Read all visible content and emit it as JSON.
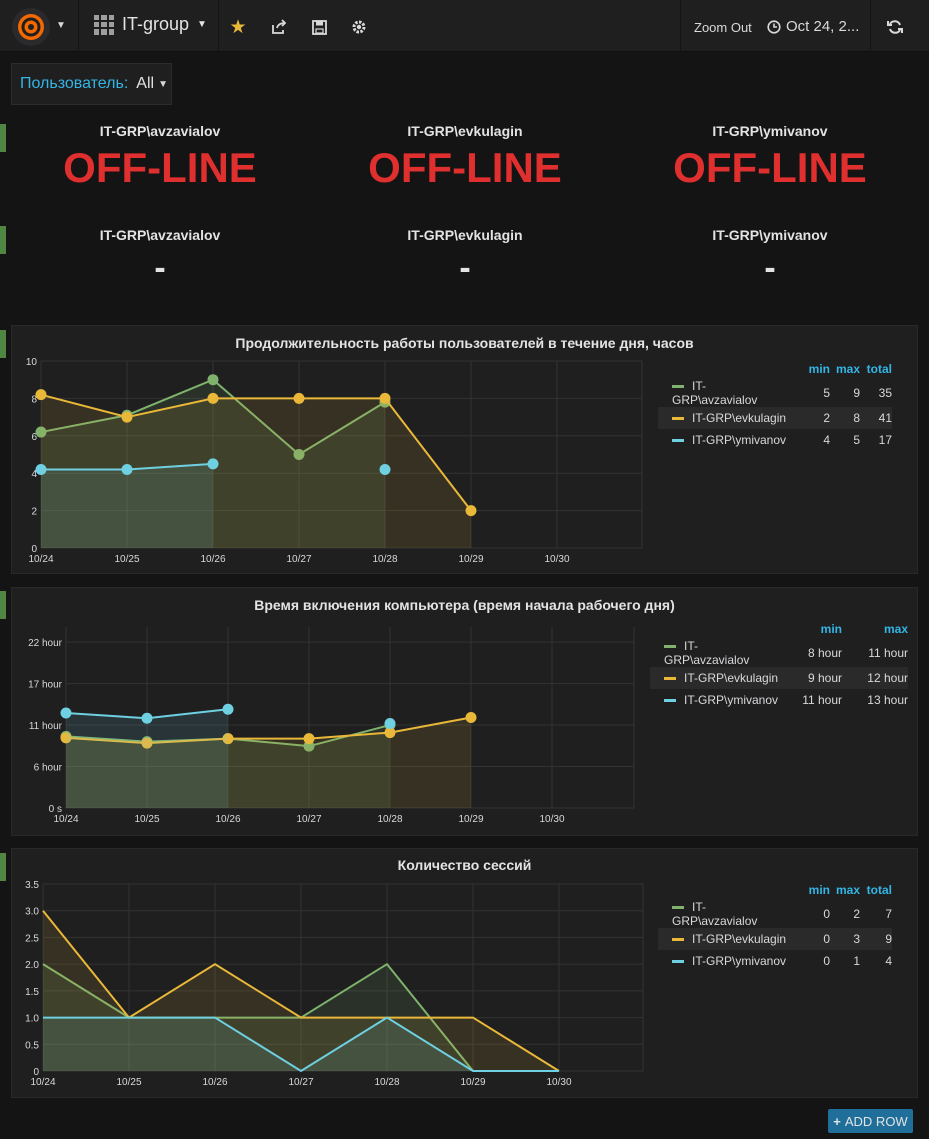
{
  "topbar": {
    "dashboard_title": "IT-group",
    "zoom_out_label": "Zoom Out",
    "time_range_label": "Oct 24, 2..."
  },
  "variable": {
    "label": "Пользователь:",
    "value": "All"
  },
  "status_rows": {
    "row1": [
      {
        "user": "IT-GRP\\avzavialov",
        "value": "OFF-LINE"
      },
      {
        "user": "IT-GRP\\evkulagin",
        "value": "OFF-LINE"
      },
      {
        "user": "IT-GRP\\ymivanov",
        "value": "OFF-LINE"
      }
    ],
    "row2": [
      {
        "user": "IT-GRP\\avzavialov",
        "value": "-"
      },
      {
        "user": "IT-GRP\\evkulagin",
        "value": "-"
      },
      {
        "user": "IT-GRP\\ymivanov",
        "value": "-"
      }
    ]
  },
  "colors": {
    "green": "#7eb26d",
    "yellow": "#eab839",
    "cyan": "#6ed0e0",
    "offline": "#e02f2f",
    "accent": "#33b5e5",
    "row_marker": "#508642"
  },
  "add_row_label": "ADD ROW",
  "chart_data": [
    {
      "type": "line",
      "title": "Продолжительность работы пользователей в течение дня, часов",
      "x": [
        "10/24",
        "10/25",
        "10/26",
        "10/27",
        "10/28",
        "10/29",
        "10/30"
      ],
      "ylim": [
        0,
        10
      ],
      "yticks": [
        "0",
        "2",
        "4",
        "6",
        "8",
        "10"
      ],
      "legend_columns": [
        "min",
        "max",
        "total"
      ],
      "series": [
        {
          "name": "IT-GRP\\avzavialov",
          "color": "#7eb26d",
          "values": [
            6.2,
            7.1,
            9,
            5,
            7.8,
            null,
            null
          ],
          "stats": [
            "5",
            "9",
            "35"
          ]
        },
        {
          "name": "IT-GRP\\evkulagin",
          "color": "#eab839",
          "values": [
            8.2,
            7,
            8,
            8,
            8,
            2,
            null
          ],
          "stats": [
            "2",
            "8",
            "41"
          ]
        },
        {
          "name": "IT-GRP\\ymivanov",
          "color": "#6ed0e0",
          "values": [
            4.2,
            4.2,
            4.5,
            null,
            4.2,
            null,
            null
          ],
          "stats": [
            "4",
            "5",
            "17"
          ]
        }
      ]
    },
    {
      "type": "line",
      "title": "Время включения компьютера (время начала рабочего дня)",
      "x": [
        "10/24",
        "10/25",
        "10/26",
        "10/27",
        "10/28",
        "10/29",
        "10/30"
      ],
      "ylim": [
        0,
        24
      ],
      "yticks": [
        "0 s",
        "6 hour",
        "11 hour",
        "17 hour",
        "22 hour"
      ],
      "ytick_values": [
        0,
        5.5,
        11,
        16.5,
        22
      ],
      "legend_columns": [
        "min",
        "max"
      ],
      "series": [
        {
          "name": "IT-GRP\\avzavialov",
          "color": "#7eb26d",
          "values": [
            9.5,
            8.8,
            9.2,
            8.2,
            11,
            null,
            null
          ],
          "stats": [
            "8 hour",
            "11 hour"
          ]
        },
        {
          "name": "IT-GRP\\evkulagin",
          "color": "#eab839",
          "values": [
            9.3,
            8.6,
            9.2,
            9.2,
            10,
            12,
            null
          ],
          "stats": [
            "9 hour",
            "12 hour"
          ]
        },
        {
          "name": "IT-GRP\\ymivanov",
          "color": "#6ed0e0",
          "values": [
            12.6,
            11.9,
            13.1,
            null,
            11.2,
            null,
            null
          ],
          "stats": [
            "11 hour",
            "13 hour"
          ]
        }
      ]
    },
    {
      "type": "line",
      "title": "Количество сессий",
      "x": [
        "10/24",
        "10/25",
        "10/26",
        "10/27",
        "10/28",
        "10/29",
        "10/30"
      ],
      "ylim": [
        0,
        3.5
      ],
      "yticks": [
        "0",
        "0.5",
        "1.0",
        "1.5",
        "2.0",
        "2.5",
        "3.0",
        "3.5"
      ],
      "legend_columns": [
        "min",
        "max",
        "total"
      ],
      "series": [
        {
          "name": "IT-GRP\\avzavialov",
          "color": "#7eb26d",
          "values": [
            2,
            1,
            1,
            1,
            2,
            0,
            null
          ],
          "stats": [
            "0",
            "2",
            "7"
          ]
        },
        {
          "name": "IT-GRP\\evkulagin",
          "color": "#eab839",
          "values": [
            3,
            1,
            2,
            1,
            1,
            1,
            0
          ],
          "stats": [
            "0",
            "3",
            "9"
          ]
        },
        {
          "name": "IT-GRP\\ymivanov",
          "color": "#6ed0e0",
          "values": [
            1,
            1,
            1,
            0,
            1,
            0,
            0
          ],
          "stats": [
            "0",
            "1",
            "4"
          ]
        }
      ]
    }
  ]
}
